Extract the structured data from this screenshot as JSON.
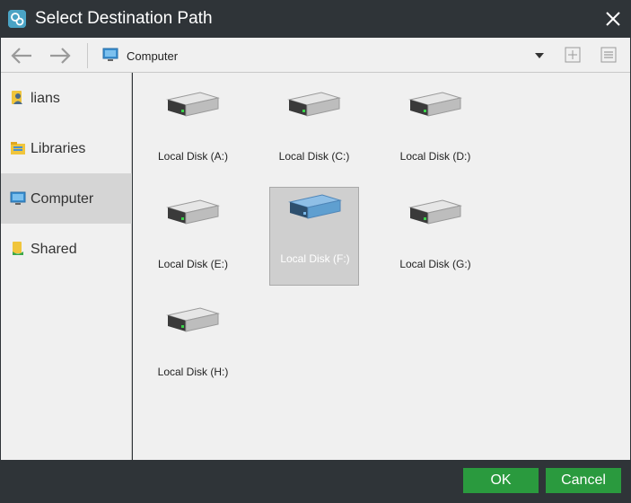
{
  "window": {
    "title": "Select Destination Path"
  },
  "toolbar": {
    "path_label": "Computer"
  },
  "sidebar": {
    "items": [
      {
        "label": "lians",
        "icon": "user-icon",
        "selected": false
      },
      {
        "label": "Libraries",
        "icon": "libraries-icon",
        "selected": false
      },
      {
        "label": "Computer",
        "icon": "computer-icon",
        "selected": true
      },
      {
        "label": "Shared",
        "icon": "shared-icon",
        "selected": false
      }
    ]
  },
  "disks": [
    {
      "label": "Local Disk (A:)",
      "selected": false
    },
    {
      "label": "Local Disk (C:)",
      "selected": false
    },
    {
      "label": "Local Disk (D:)",
      "selected": false
    },
    {
      "label": "Local Disk (E:)",
      "selected": false
    },
    {
      "label": "Local Disk (F:)",
      "selected": true
    },
    {
      "label": "Local Disk (G:)",
      "selected": false
    },
    {
      "label": "Local Disk (H:)",
      "selected": false
    }
  ],
  "footer": {
    "ok_label": "OK",
    "cancel_label": "Cancel"
  },
  "colors": {
    "chrome": "#2f3438",
    "accent_green": "#2a9a3e",
    "selection": "#d5d5d5"
  }
}
